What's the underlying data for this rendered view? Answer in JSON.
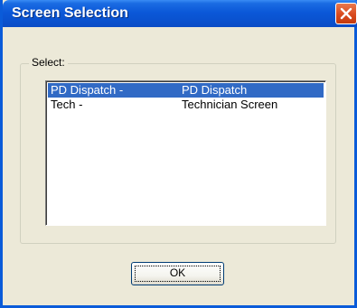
{
  "window": {
    "title": "Screen Selection"
  },
  "icons": {
    "close": "close-icon"
  },
  "colors": {
    "titlebar": "#0a58d8",
    "selection": "#316ac5",
    "close": "#d94a1e"
  },
  "group": {
    "label": "Select:"
  },
  "list": {
    "items": [
      {
        "code": "PD Dispatch -",
        "name": "PD Dispatch",
        "selected": true
      },
      {
        "code": "Tech -",
        "name": "Technician Screen",
        "selected": false
      }
    ]
  },
  "buttons": {
    "ok_label": "OK"
  }
}
